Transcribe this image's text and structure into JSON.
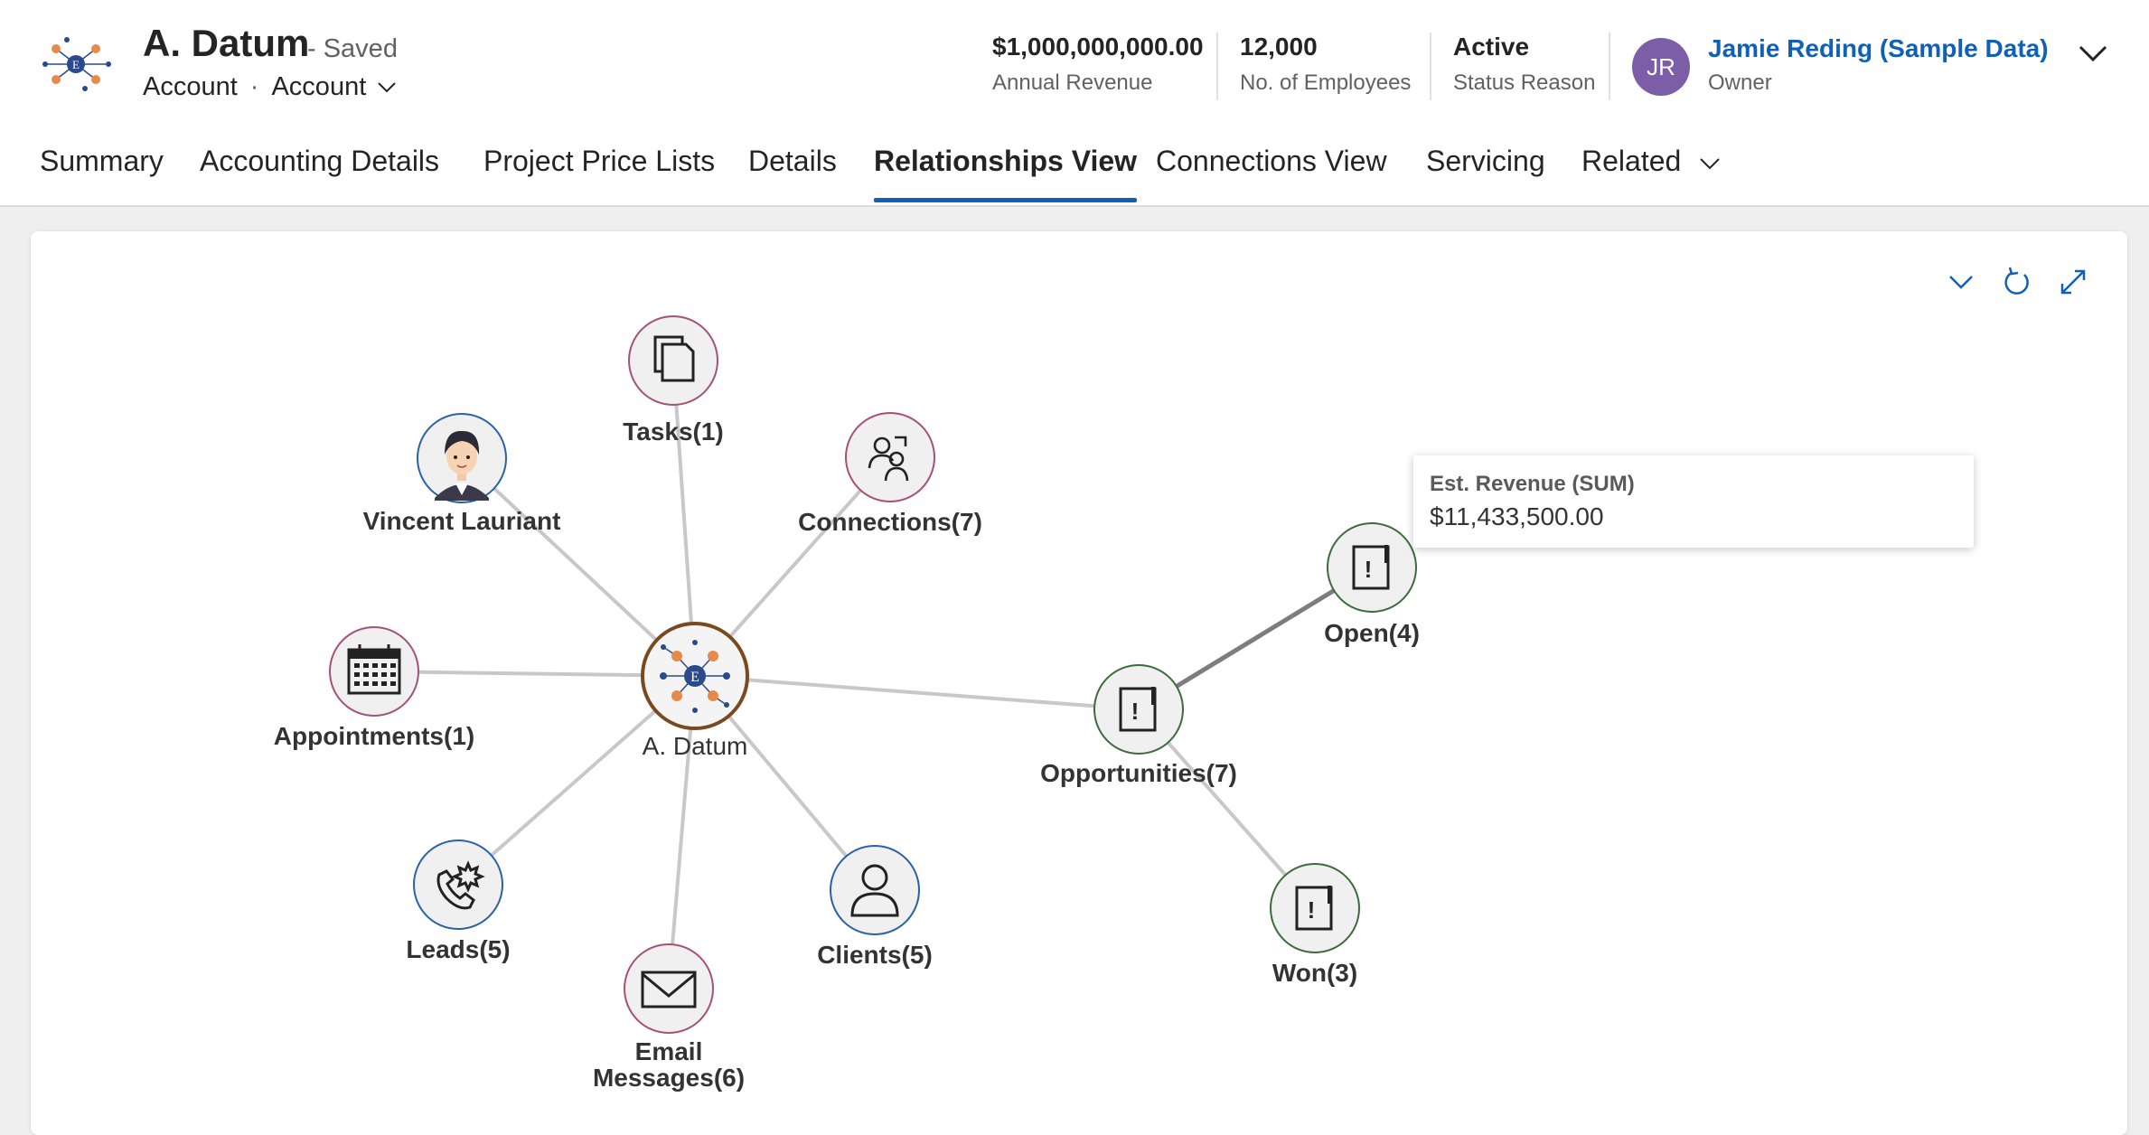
{
  "record": {
    "title": "A. Datum",
    "saved_status": "- Saved",
    "entity_type": "Account",
    "form_name": "Account"
  },
  "kpis": [
    {
      "value": "$1,000,000,000.00",
      "label": "Annual Revenue"
    },
    {
      "value": "12,000",
      "label": "No. of Employees"
    },
    {
      "value": "Active",
      "label": "Status Reason"
    }
  ],
  "owner": {
    "initials": "JR",
    "name": "Jamie Reding (Sample Data)",
    "label": "Owner",
    "avatar_color": "#7b5ea7"
  },
  "tabs": [
    {
      "label": "Summary"
    },
    {
      "label": "Accounting Details"
    },
    {
      "label": "Project Price Lists"
    },
    {
      "label": "Details"
    },
    {
      "label": "Relationships View",
      "active": true
    },
    {
      "label": "Connections View"
    },
    {
      "label": "Servicing"
    },
    {
      "label": "Related"
    }
  ],
  "toolbar": {
    "icons": [
      "chevron-down-icon",
      "refresh-icon",
      "expand-icon"
    ]
  },
  "graph": {
    "center": {
      "label": "A. Datum",
      "icon": "account-logo-icon"
    },
    "nodes": [
      {
        "label": "Tasks(1)",
        "icon": "tasks-icon"
      },
      {
        "label": "Vincent Lauriant",
        "icon": "contact-avatar-icon"
      },
      {
        "label": "Connections(7)",
        "icon": "connections-icon"
      },
      {
        "label": "Appointments(1)",
        "icon": "calendar-icon"
      },
      {
        "label": "Leads(5)",
        "icon": "phone-icon"
      },
      {
        "label": "Email Messages(6)",
        "label_line1": "Email",
        "label_line2": "Messages(6)",
        "icon": "email-icon"
      },
      {
        "label": "Clients(5)",
        "icon": "person-icon"
      },
      {
        "label": "Opportunities(7)",
        "icon": "opportunity-icon"
      },
      {
        "label": "Open(4)",
        "icon": "opportunity-icon"
      },
      {
        "label": "Won(3)",
        "icon": "opportunity-icon"
      }
    ],
    "colors": {
      "pink_border": "#a5517a",
      "blue_border": "#2a61a8",
      "green_border": "#3d6b3d",
      "center_border": "#7a4a1f",
      "edge": "#c8c8c8",
      "edge_highlight": "#7d7d7d"
    }
  },
  "tooltip": {
    "label": "Est. Revenue (SUM)",
    "value": "$11,433,500.00"
  }
}
